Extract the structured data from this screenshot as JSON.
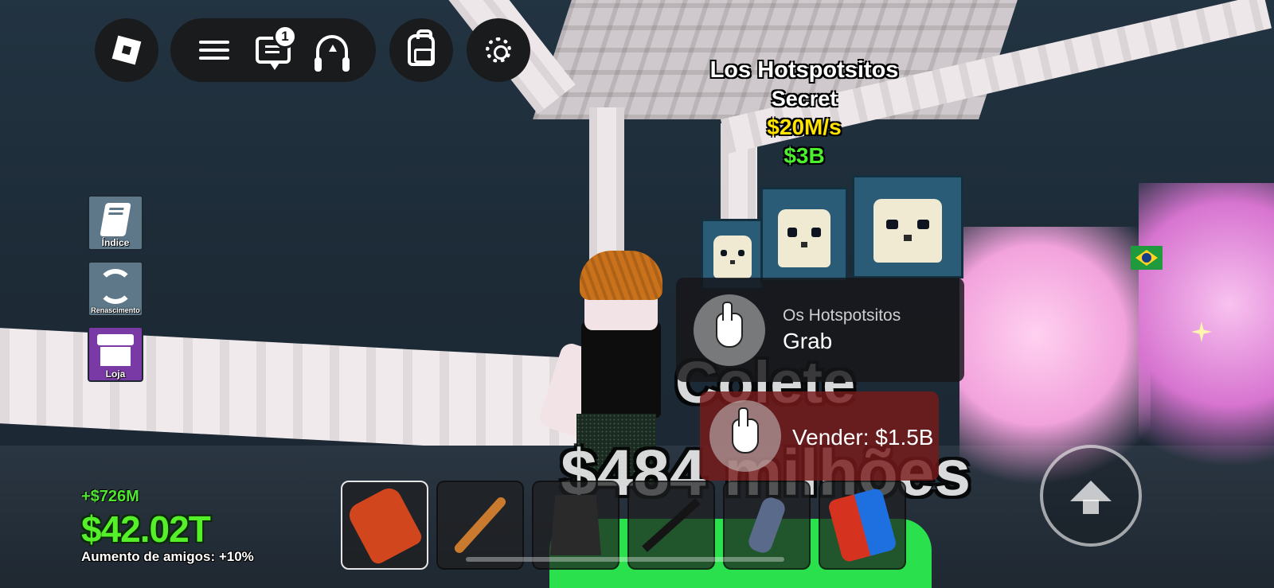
{
  "game": {
    "topbar": {
      "chat_unread": "1"
    },
    "nametag": {
      "name": "Los Hotspotsitos",
      "rarity": "Secret",
      "rate": "$20M/s",
      "price": "$3B"
    },
    "side_buttons": {
      "indice": "Índice",
      "renascimento": "Renascimento",
      "loja": "Loja"
    },
    "prompts": {
      "grab": {
        "object": "Os Hotspotsitos",
        "action": "Grab"
      },
      "sell": {
        "action": "Vender: $1.5B"
      }
    },
    "overlay": {
      "collect": "Colete",
      "amount": "$484 milhões"
    },
    "hotbar": {
      "slots": [
        {
          "tool": "slap-glove-icon"
        },
        {
          "tool": "baseball-bat-icon"
        },
        {
          "tool": "cape-icon"
        },
        {
          "tool": "grapple-gun-icon"
        },
        {
          "tool": "gadget-icon"
        },
        {
          "tool": "fist-icon"
        }
      ]
    },
    "money": {
      "income": "+$726M",
      "balance": "$42.02T",
      "friend_boost": "Aumento de amigos: +10%"
    }
  },
  "colors": {
    "money_green": "#55f02a",
    "rate_yellow": "#ffe400",
    "loja_purple": "#7a3aa5",
    "sell_red": "#781a1a"
  }
}
